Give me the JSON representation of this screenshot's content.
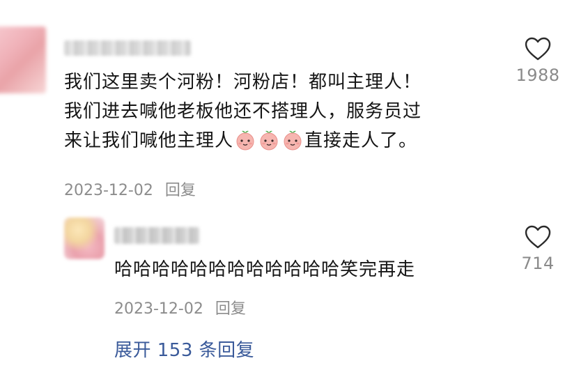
{
  "comment": {
    "text_before_emoji": "我们这里卖个河粉！河粉店！都叫主理人！\n我们进去喊他老板他还不搭理人，服务员过\n来让我们喊他主理人",
    "emoji_name": "peach-face-emoji",
    "text_after_emoji": "直接走人了。",
    "date": "2023-12-02",
    "reply_label": "回复",
    "like_count": "1988"
  },
  "reply": {
    "text": "哈哈哈哈哈哈哈哈哈哈哈哈笑完再走",
    "date": "2023-12-02",
    "reply_label": "回复",
    "like_count": "714"
  },
  "expand_replies": {
    "label": "展开 153 条回复"
  },
  "colors": {
    "text": "#151515",
    "meta": "#8c8c8c",
    "link": "#3a5a9a",
    "emoji_face": "#f6b6b0",
    "emoji_leaf": "#5bb45a"
  },
  "icons": {
    "like": "heart-outline-icon"
  }
}
